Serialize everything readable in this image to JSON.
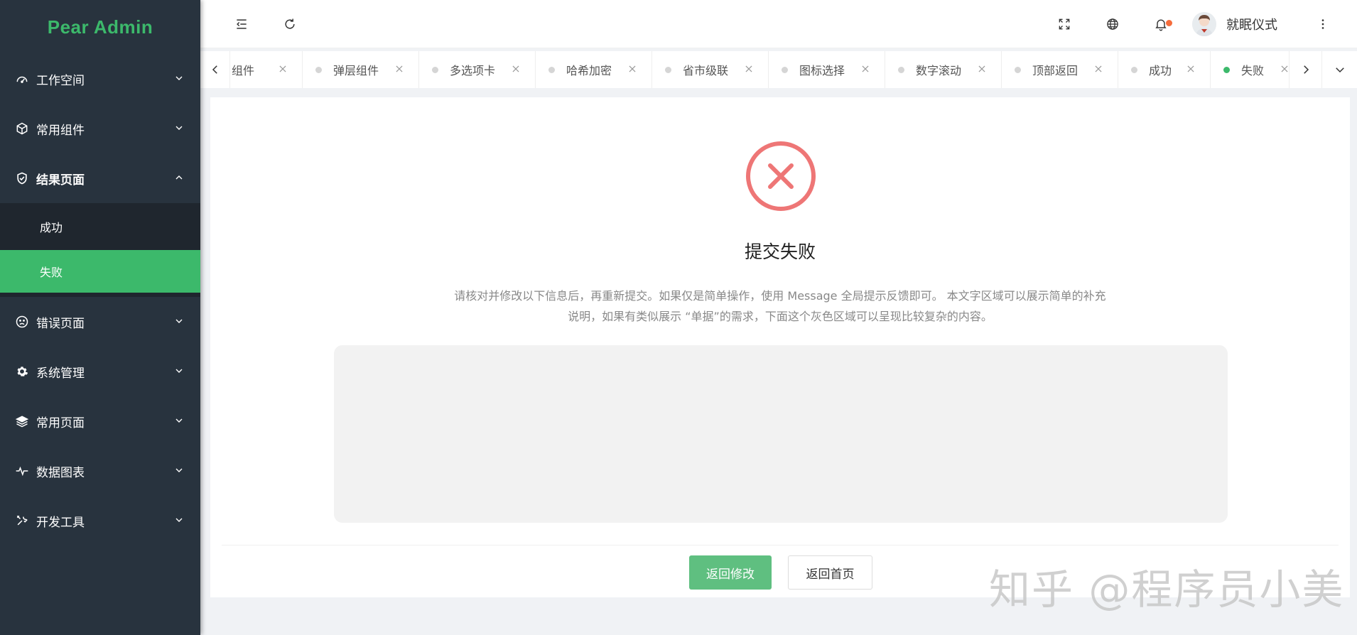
{
  "app": {
    "logo": "Pear Admin"
  },
  "sidebar": {
    "items": [
      {
        "label": "工作空间",
        "icon": "gauge-icon",
        "expanded": false
      },
      {
        "label": "常用组件",
        "icon": "cube-icon",
        "expanded": false
      },
      {
        "label": "结果页面",
        "icon": "shield-check-icon",
        "expanded": true,
        "children": [
          {
            "label": "成功",
            "active": false
          },
          {
            "label": "失败",
            "active": true
          }
        ]
      },
      {
        "label": "错误页面",
        "icon": "sad-face-icon",
        "expanded": false
      },
      {
        "label": "系统管理",
        "icon": "gear-icon",
        "expanded": false
      },
      {
        "label": "常用页面",
        "icon": "layers-icon",
        "expanded": false
      },
      {
        "label": "数据图表",
        "icon": "pulse-icon",
        "expanded": false
      },
      {
        "label": "开发工具",
        "icon": "tools-icon",
        "expanded": false
      }
    ]
  },
  "header": {
    "user_name": "就眠仪式",
    "notification_dot_color": "#f56c3b"
  },
  "tabs": [
    {
      "label": "组件",
      "active": false
    },
    {
      "label": "弹层组件",
      "active": false
    },
    {
      "label": "多选项卡",
      "active": false
    },
    {
      "label": "哈希加密",
      "active": false
    },
    {
      "label": "省市级联",
      "active": false
    },
    {
      "label": "图标选择",
      "active": false
    },
    {
      "label": "数字滚动",
      "active": false
    },
    {
      "label": "顶部返回",
      "active": false
    },
    {
      "label": "成功",
      "active": false
    },
    {
      "label": "失败",
      "active": true
    }
  ],
  "result": {
    "title": "提交失败",
    "description": "请核对并修改以下信息后，再重新提交。如果仅是简单操作，使用 Message 全局提示反馈即可。 本文字区域可以展示简单的补充说明，如果有类似展示 “单据”的需求，下面这个灰色区域可以呈现比较复杂的内容。",
    "primary_button": "返回修改",
    "secondary_button": "返回首页",
    "error_color": "#ee7676"
  },
  "colors": {
    "brand": "#3cb96b",
    "sidebar_bg": "#28333e",
    "primary_button": "#5fbf80"
  },
  "watermark": "知乎 @程序员小美"
}
